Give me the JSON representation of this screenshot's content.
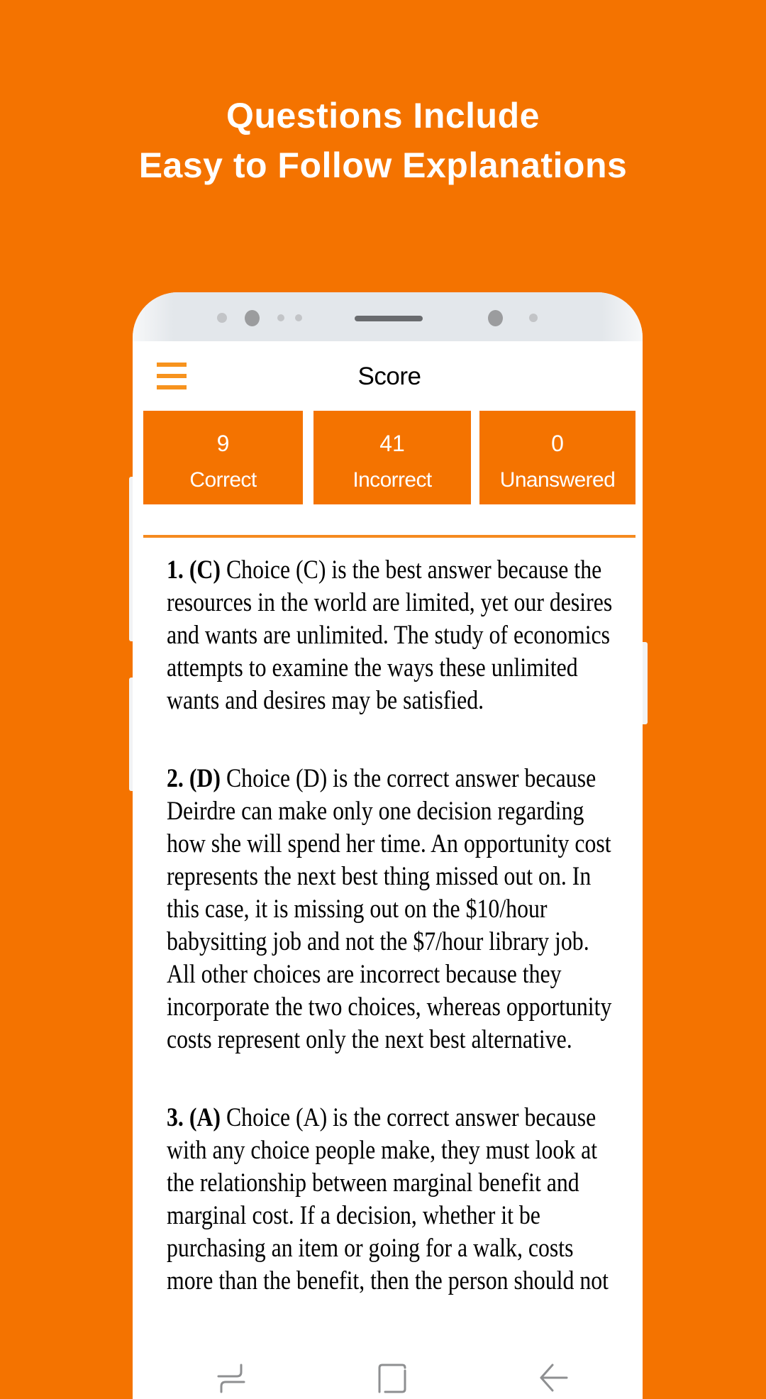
{
  "promo": {
    "headline_line1": "Questions Include",
    "headline_line2": "Easy to Follow Explanations",
    "background_color": "#f47300"
  },
  "app": {
    "title": "Score",
    "menu_icon": "hamburger-menu-icon",
    "accent_color": "#f47300"
  },
  "stats": [
    {
      "value": "9",
      "label": "Correct"
    },
    {
      "value": "41",
      "label": "Incorrect"
    },
    {
      "value": "0",
      "label": "Unanswered"
    }
  ],
  "explanations": [
    {
      "marker": "1. (C)",
      "lines": [
        " Choice (C) is the best answer because the",
        "resources in the world are limited, yet our desires",
        "and wants are unlimited. The study of economics",
        "attempts to examine the ways these unlimited",
        "wants and desires may be satisfied."
      ]
    },
    {
      "marker": "2. (D)",
      "lines": [
        " Choice (D) is the correct answer because",
        "Deirdre can make only one decision regarding",
        "how she will spend her time. An opportunity cost",
        "represents the next best thing missed out on. In",
        "this case, it is missing out on the $10/hour",
        "babysitting job and not the $7/hour library job.",
        "All other choices are incorrect because they",
        "incorporate the two choices, whereas opportunity",
        "costs represent only the next best alternative."
      ]
    },
    {
      "marker": "3. (A)",
      "lines": [
        " Choice (A) is the correct answer because",
        "with any choice people make, they must look at",
        "the relationship between marginal benefit and",
        "marginal cost. If a decision, whether it be",
        "purchasing an item or going for a walk, costs",
        "more than the benefit, then the person should not"
      ]
    }
  ],
  "navbar": {
    "icons": [
      "recent-apps-icon",
      "home-icon",
      "back-icon"
    ]
  }
}
